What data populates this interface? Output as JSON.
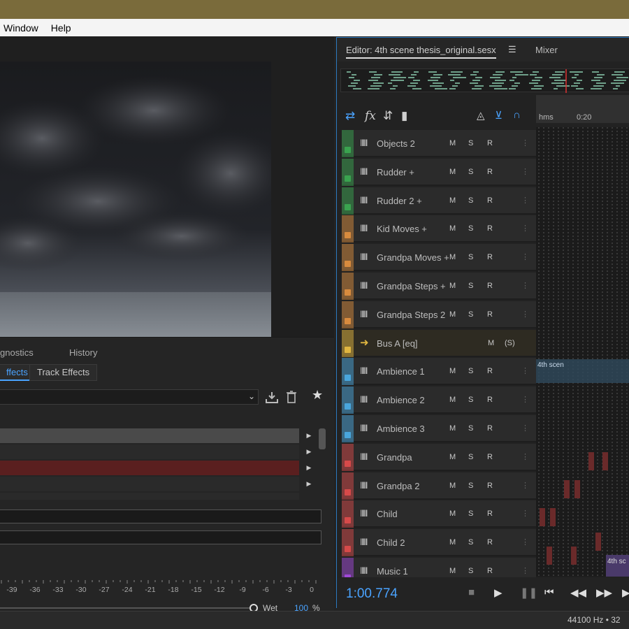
{
  "menu": {
    "items": [
      "Window",
      "Help"
    ]
  },
  "left_panel": {
    "tabs": [
      "gnostics",
      "History"
    ],
    "subtabs": [
      "ffects",
      "Track Effects"
    ],
    "wet": {
      "label": "Wet",
      "value": "100",
      "unit": "%"
    },
    "scale": [
      "-39",
      "-36",
      "-33",
      "-30",
      "-27",
      "-24",
      "-21",
      "-18",
      "-15",
      "-12",
      "-9",
      "-6",
      "-3",
      "0"
    ]
  },
  "editor": {
    "tab_title": "Editor: 4th scene thesis_original.sesx",
    "menu_glyph": "☰",
    "mixer_label": "Mixer",
    "ruler_label": "hms",
    "ruler_tick": "0:20",
    "timecode": "1:00.774",
    "tracks": [
      {
        "name": "Objects 2",
        "color": "#3aa34f",
        "type": "audio"
      },
      {
        "name": "Rudder +",
        "color": "#3aa34f",
        "type": "audio"
      },
      {
        "name": "Rudder 2 +",
        "color": "#3aa34f",
        "type": "audio"
      },
      {
        "name": "Kid Moves +",
        "color": "#d88b3e",
        "type": "audio"
      },
      {
        "name": "Grandpa Moves +",
        "color": "#d88b3e",
        "type": "audio"
      },
      {
        "name": "Grandpa Steps +",
        "color": "#d88b3e",
        "type": "audio"
      },
      {
        "name": "Grandpa Steps 2",
        "color": "#d88b3e",
        "type": "audio"
      },
      {
        "name": "Bus A [eq]",
        "color": "#e0b640",
        "type": "bus"
      },
      {
        "name": "Ambience 1",
        "color": "#49a6dc",
        "type": "audio"
      },
      {
        "name": "Ambience 2",
        "color": "#49a6dc",
        "type": "audio"
      },
      {
        "name": "Ambience 3",
        "color": "#49a6dc",
        "type": "audio"
      },
      {
        "name": "Grandpa",
        "color": "#d64a4a",
        "type": "audio"
      },
      {
        "name": "Grandpa 2",
        "color": "#d64a4a",
        "type": "audio"
      },
      {
        "name": "Child",
        "color": "#d64a4a",
        "type": "audio"
      },
      {
        "name": "Child 2",
        "color": "#d64a4a",
        "type": "audio"
      },
      {
        "name": "Music 1",
        "color": "#a048d8",
        "type": "audio"
      }
    ],
    "buttons": {
      "m": "M",
      "s": "S",
      "r": "R",
      "s_bus": "(S)"
    },
    "clip_labels": [
      "4th scen",
      "4th sc"
    ]
  },
  "status": {
    "text": "44100 Hz • 32"
  }
}
